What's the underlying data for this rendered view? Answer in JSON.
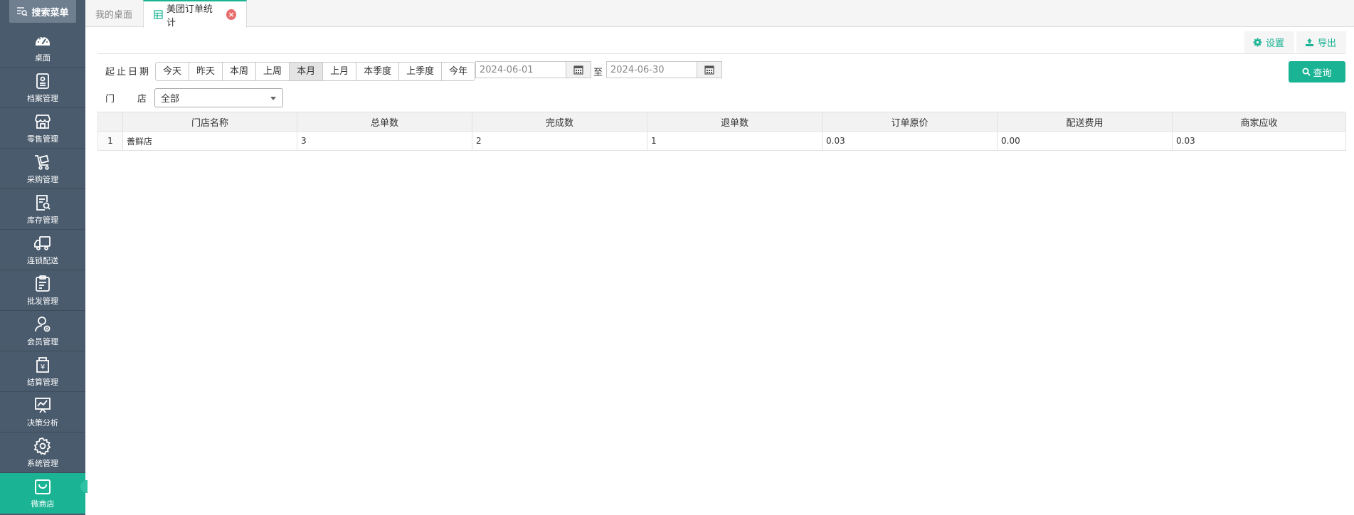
{
  "sidebar": {
    "search_label": "搜索菜单",
    "items": [
      {
        "label": "桌面",
        "icon": "dashboard-icon"
      },
      {
        "label": "档案管理",
        "icon": "archive-icon"
      },
      {
        "label": "零售管理",
        "icon": "store-icon"
      },
      {
        "label": "采购管理",
        "icon": "cart-icon"
      },
      {
        "label": "库存管理",
        "icon": "inventory-icon"
      },
      {
        "label": "连锁配送",
        "icon": "truck-icon"
      },
      {
        "label": "批发管理",
        "icon": "wholesale-icon"
      },
      {
        "label": "会员管理",
        "icon": "member-icon"
      },
      {
        "label": "结算管理",
        "icon": "settlement-icon"
      },
      {
        "label": "决策分析",
        "icon": "analysis-icon"
      },
      {
        "label": "系统管理",
        "icon": "gear-icon"
      },
      {
        "label": "微商店",
        "icon": "shop-bag-icon",
        "active": true
      }
    ]
  },
  "tabs": {
    "home": "我的桌面",
    "current": "美团订单统计"
  },
  "toolbar": {
    "settings_label": "设置",
    "export_label": "导出"
  },
  "filters": {
    "date_label": "起止日期",
    "quick_ranges": [
      "今天",
      "昨天",
      "本周",
      "上周",
      "本月",
      "上月",
      "本季度",
      "上季度",
      "今年"
    ],
    "selected_range": "本月",
    "start_date": "2024-06-01",
    "end_date": "2024-06-30",
    "to_label": "至",
    "store_label_1": "门",
    "store_label_2": "店",
    "store_value": "全部",
    "query_label": "查询"
  },
  "table": {
    "headers": [
      "门店名称",
      "总单数",
      "完成数",
      "退单数",
      "订单原价",
      "配送费用",
      "商家应收"
    ],
    "rows": [
      {
        "index": "1",
        "cells": [
          "善鲜店",
          "3",
          "2",
          "1",
          "0.03",
          "0.00",
          "0.03"
        ]
      }
    ]
  },
  "colors": {
    "sidebar_bg": "#4a5b6d",
    "accent": "#1ab394",
    "close_badge": "#e86c6c"
  }
}
